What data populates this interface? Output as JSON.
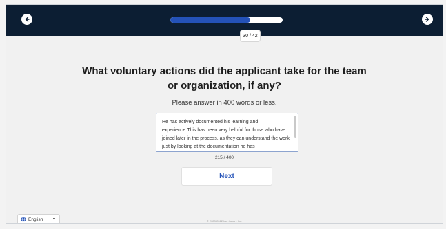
{
  "header": {
    "back_icon": "arrow-left-icon",
    "forward_icon": "arrow-right-icon",
    "progress": {
      "current": 30,
      "total": 42,
      "label": "30 / 42",
      "fill_fraction": 0.71
    },
    "colors": {
      "bar_background": "#0c1e33",
      "progress_fill": "#2452b8"
    }
  },
  "question": {
    "line1": "What voluntary actions did the applicant take for the team",
    "line2": "or organization, if any?"
  },
  "instructions": "Please answer in 400 words or less.",
  "answer": {
    "text": "He has actively documented his learning and experience.This has been very helpful for those who have joined later in the process, as they can understand the work just by looking at the documentation he has",
    "word_count": "215 / 400"
  },
  "next_button": {
    "label": "Next",
    "color": "#2553b9"
  },
  "language": {
    "selected": "English",
    "icon": "globe-icon"
  },
  "footer": "© 2023-2022 Inc. Japan. Inc."
}
